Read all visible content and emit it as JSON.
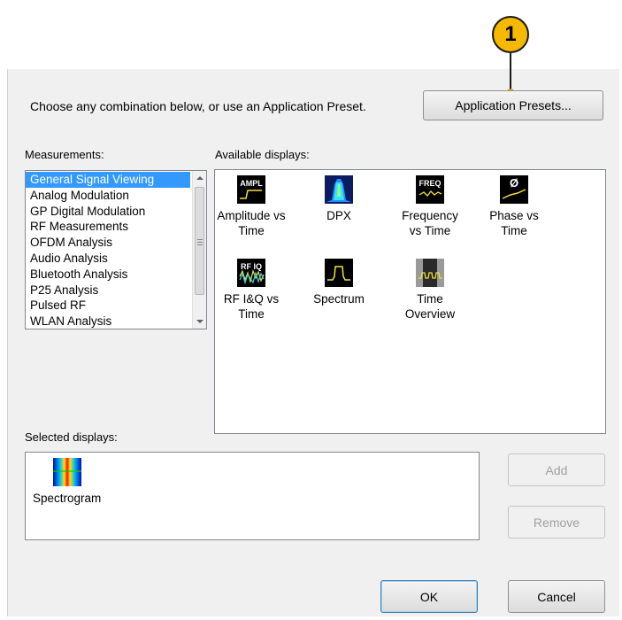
{
  "callout": {
    "number": "1"
  },
  "top": {
    "instruction": "Choose any combination below, or use an Application Preset.",
    "presets_button": "Application Presets..."
  },
  "measurements": {
    "label": "Measurements:",
    "items": [
      "General Signal Viewing",
      "Analog Modulation",
      "GP Digital Modulation",
      "RF Measurements",
      "OFDM Analysis",
      "Audio Analysis",
      "Bluetooth Analysis",
      "P25 Analysis",
      "Pulsed RF",
      "WLAN Analysis"
    ],
    "selected": "General Signal Viewing"
  },
  "available": {
    "label": "Available displays:",
    "tiles": [
      {
        "label1": "Amplitude vs",
        "label2": "Time",
        "icon_text": "AMPL",
        "icon": "amplitude-vs-time-icon"
      },
      {
        "label1": "DPX",
        "label2": "",
        "icon_text": "",
        "icon": "dpx-icon"
      },
      {
        "label1": "Frequency",
        "label2": "vs Time",
        "icon_text": "FREQ",
        "icon": "frequency-vs-time-icon"
      },
      {
        "label1": "Phase vs",
        "label2": "Time",
        "icon_text": "Ø",
        "icon": "phase-vs-time-icon"
      },
      {
        "label1": "RF I&Q vs",
        "label2": "Time",
        "icon_text": "RF IQ",
        "icon": "rf-iq-vs-time-icon"
      },
      {
        "label1": "Spectrum",
        "label2": "",
        "icon_text": "",
        "icon": "spectrum-icon"
      },
      {
        "label1": "Time",
        "label2": "Overview",
        "icon_text": "",
        "icon": "time-overview-icon"
      }
    ]
  },
  "selected_displays": {
    "label": "Selected displays:",
    "items": [
      {
        "label": "Spectrogram",
        "icon": "spectrogram-icon"
      }
    ]
  },
  "buttons": {
    "add": "Add",
    "remove": "Remove",
    "ok": "OK",
    "cancel": "Cancel"
  },
  "colors": {
    "selection": "#3399ff",
    "callout": "#f7b800",
    "trace_yellow": "#f0e040"
  }
}
